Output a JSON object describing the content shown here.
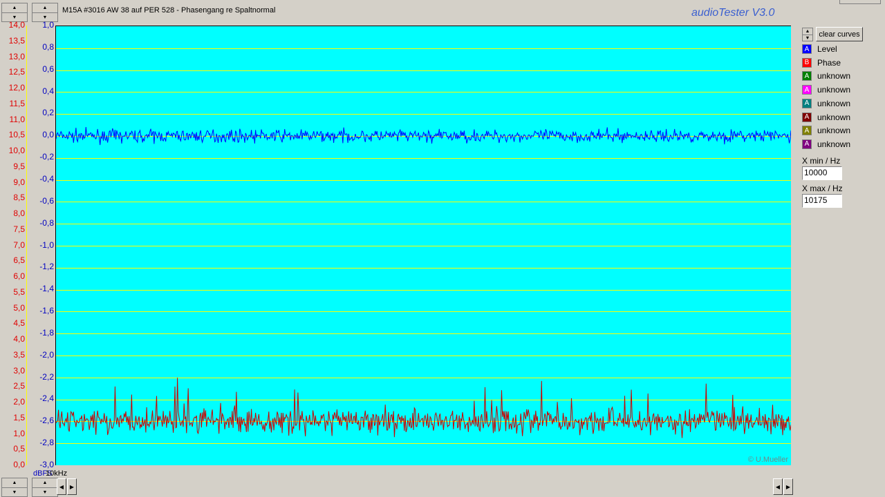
{
  "window": {
    "title": "M15A #3016 AW 38 auf PER 528 - Phasengang re Spaltnormal",
    "brand": "audioTester  V3.0"
  },
  "left_axis": {
    "unit": "dBFS",
    "labels": [
      "14,0",
      "13,5",
      "13,0",
      "12,5",
      "12,0",
      "11,5",
      "11,0",
      "10,5",
      "10,0",
      "9,5",
      "9,0",
      "8,5",
      "8,0",
      "7,5",
      "7,0",
      "6,5",
      "6,0",
      "5,5",
      "5,0",
      "4,5",
      "4,0",
      "3,5",
      "3,0",
      "2,5",
      "2,0",
      "1,5",
      "1,0",
      "0,5",
      "0,0"
    ],
    "color": "#e00000"
  },
  "right_axis": {
    "labels": [
      "1,0",
      "0,8",
      "0,6",
      "0,4",
      "0,2",
      "0,0",
      "-0,2",
      "-0,4",
      "-0,6",
      "-0,8",
      "-1,0",
      "-1,2",
      "-1,4",
      "-1,6",
      "-1,8",
      "-2,0",
      "-2,2",
      "-2,4",
      "-2,6",
      "-2,8",
      "-3,0"
    ],
    "color": "#0000c0"
  },
  "x_axis": {
    "label": "10kHz"
  },
  "plot": {
    "background": "#00ffff",
    "grid_color": "#ffff00",
    "copyright": "© U.Mueller"
  },
  "side_panel": {
    "clear_button": "clear curves",
    "legend": [
      {
        "letter": "A",
        "label": "Level",
        "color": "#0000ff"
      },
      {
        "letter": "B",
        "label": "Phase",
        "color": "#ff0000"
      },
      {
        "letter": "A",
        "label": "unknown",
        "color": "#008000"
      },
      {
        "letter": "A",
        "label": "unknown",
        "color": "#ff00ff"
      },
      {
        "letter": "A",
        "label": "unknown",
        "color": "#008080"
      },
      {
        "letter": "A",
        "label": "unknown",
        "color": "#800000"
      },
      {
        "letter": "A",
        "label": "unknown",
        "color": "#808000"
      },
      {
        "letter": "A",
        "label": "unknown",
        "color": "#800080"
      }
    ],
    "xmin_label": "X min / Hz",
    "xmin_value": "10000",
    "xmax_label": "X max / Hz",
    "xmax_value": "10175"
  },
  "chart_data": {
    "type": "line",
    "x_range": [
      10000,
      10175
    ],
    "ylim_right": [
      -3.0,
      1.0
    ],
    "ylim_left": [
      0.0,
      14.0
    ],
    "grid": true,
    "series": [
      {
        "name": "Level",
        "axis": "right",
        "color": "#0000ff",
        "approx_mean": 0.0,
        "approx_spread": 0.1
      },
      {
        "name": "Phase",
        "axis": "right",
        "color": "#cc0000",
        "approx_mean": -2.6,
        "approx_spread": 0.2
      }
    ]
  }
}
